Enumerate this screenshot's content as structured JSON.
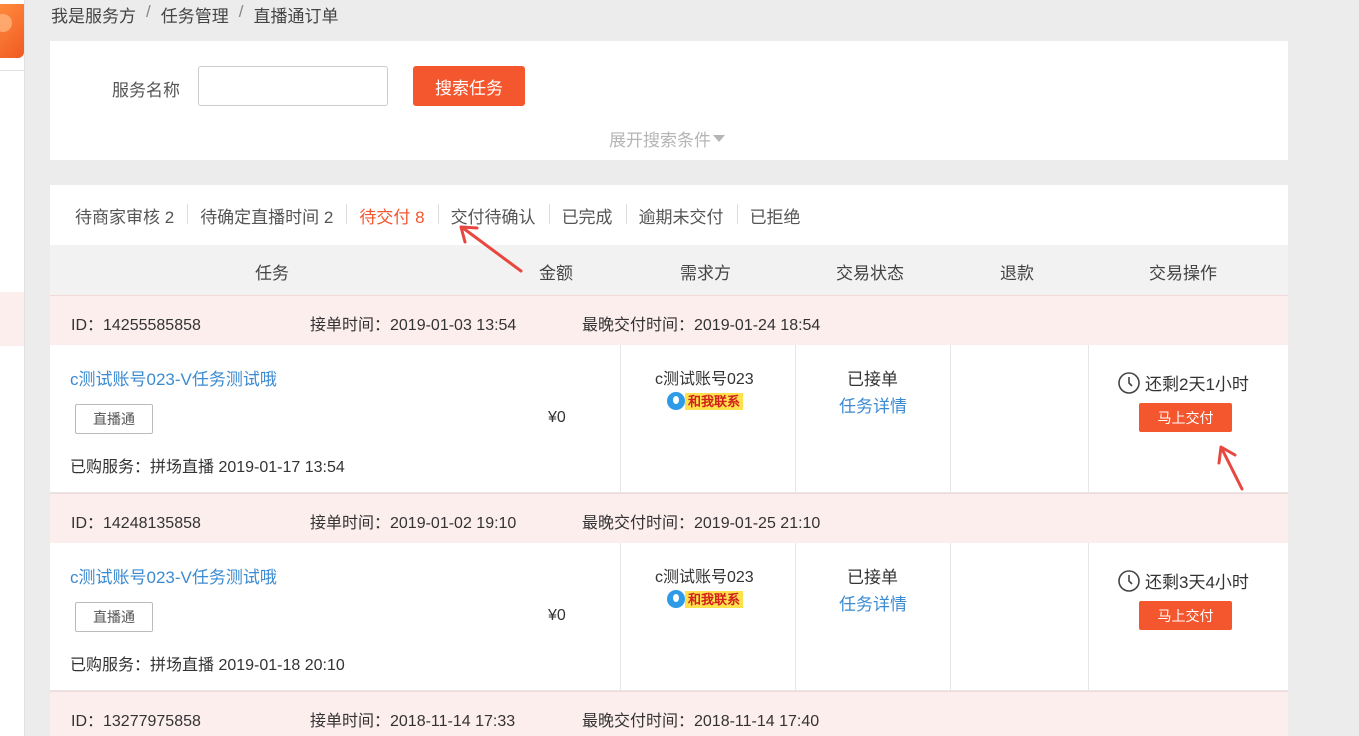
{
  "breadcrumb": [
    "我是服务方",
    "任务管理",
    "直播通订单"
  ],
  "search": {
    "label": "服务名称",
    "input_value": "",
    "button": "搜索任务",
    "expand": "展开搜索条件"
  },
  "tabs": [
    {
      "label": "待商家审核 2",
      "active": false
    },
    {
      "label": "待确定直播时间 2",
      "active": false
    },
    {
      "label": "待交付 8",
      "active": true
    },
    {
      "label": "交付待确认",
      "active": false
    },
    {
      "label": "已完成",
      "active": false
    },
    {
      "label": "逾期未交付",
      "active": false
    },
    {
      "label": "已拒绝",
      "active": false
    }
  ],
  "columns": {
    "task": "任务",
    "amount": "金额",
    "buyer": "需求方",
    "status": "交易状态",
    "refund": "退款",
    "operation": "交易操作"
  },
  "orders": [
    {
      "id": "ID：14255585858",
      "accept_time": "接单时间：2019-01-03 13:54",
      "deadline": "最晚交付时间：2019-01-24 18:54",
      "task_title": "c测试账号023-V任务测试哦",
      "tag": "直播通",
      "bought": "已购服务：拼场直播 2019-01-17 13:54",
      "amount": "¥0",
      "buyer": "c测试账号023",
      "contact": "和我联系",
      "status": "已接单",
      "detail": "任务详情",
      "remaining": "还剩2天1小时",
      "action": "马上交付"
    },
    {
      "id": "ID：14248135858",
      "accept_time": "接单时间：2019-01-02 19:10",
      "deadline": "最晚交付时间：2019-01-25 21:10",
      "task_title": "c测试账号023-V任务测试哦",
      "tag": "直播通",
      "bought": "已购服务：拼场直播 2019-01-18 20:10",
      "amount": "¥0",
      "buyer": "c测试账号023",
      "contact": "和我联系",
      "status": "已接单",
      "detail": "任务详情",
      "remaining": "还剩3天4小时",
      "action": "马上交付"
    },
    {
      "id": "ID：13277975858",
      "accept_time": "接单时间：2018-11-14 17:33",
      "deadline": "最晚交付时间：2018-11-14 17:40"
    }
  ],
  "colors": {
    "accent": "#f4562e",
    "link": "#3c8bd1",
    "order_header_bg": "#fdeeee",
    "annotation_arrow": "#e8473f"
  }
}
